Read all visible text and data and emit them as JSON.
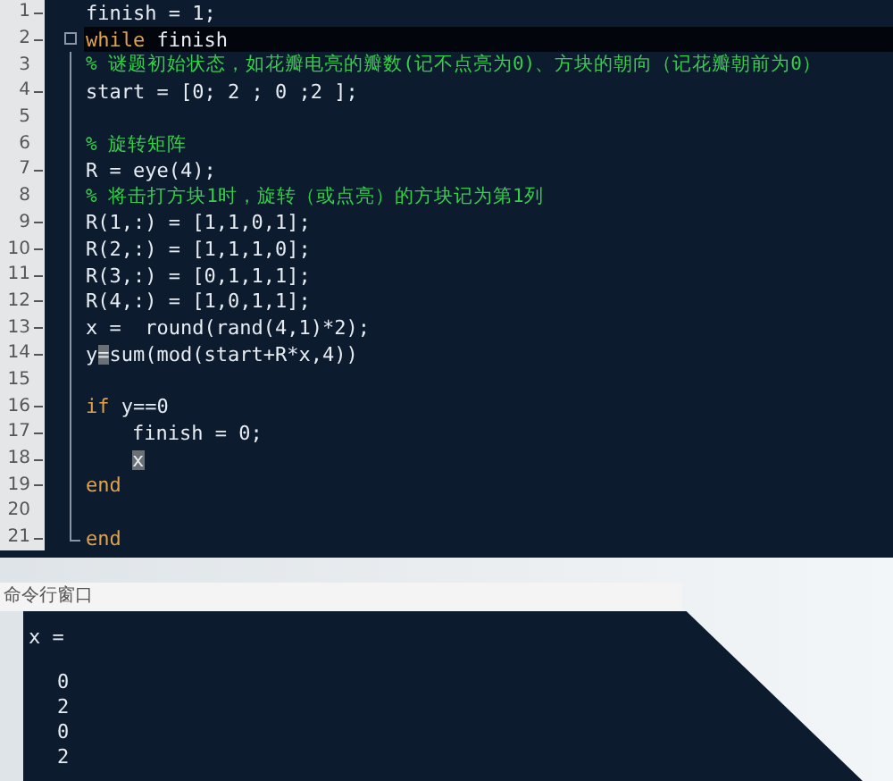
{
  "editor": {
    "lines": [
      {
        "number": "1",
        "dash": true,
        "kind": "plain",
        "current": false,
        "indented": false,
        "segments": [
          {
            "kind": "code",
            "text": "finish = 1;"
          }
        ]
      },
      {
        "number": "2",
        "dash": true,
        "kind": "foldstart",
        "current": true,
        "indented": false,
        "segments": [
          {
            "kind": "keyword",
            "text": "while"
          },
          {
            "kind": "code",
            "text": " finish"
          }
        ]
      },
      {
        "number": "3",
        "dash": false,
        "kind": "folded",
        "current": false,
        "indented": false,
        "segments": [
          {
            "kind": "comment",
            "text": "% 谜题初始状态，如花瓣电亮的瓣数(记不点亮为0)、方块的朝向（记花瓣朝前为0）"
          }
        ]
      },
      {
        "number": "4",
        "dash": true,
        "kind": "folded",
        "current": false,
        "indented": false,
        "segments": [
          {
            "kind": "code",
            "text": "start = [0; 2 ; 0 ;2 ];"
          }
        ]
      },
      {
        "number": "5",
        "dash": false,
        "kind": "folded",
        "current": false
      },
      {
        "number": "6",
        "dash": false,
        "kind": "folded",
        "current": false,
        "indented": false,
        "segments": [
          {
            "kind": "comment",
            "text": "% 旋转矩阵"
          }
        ]
      },
      {
        "number": "7",
        "dash": true,
        "kind": "folded",
        "current": false,
        "indented": false,
        "segments": [
          {
            "kind": "code",
            "text": "R = eye(4);"
          }
        ]
      },
      {
        "number": "8",
        "dash": false,
        "kind": "folded",
        "current": false,
        "indented": false,
        "segments": [
          {
            "kind": "comment",
            "text": "% 将击打方块1时，旋转（或点亮）的方块记为第1列"
          }
        ]
      },
      {
        "number": "9",
        "dash": true,
        "kind": "folded",
        "current": false,
        "indented": false,
        "segments": [
          {
            "kind": "code",
            "text": "R(1,:) = [1,1,0,1];"
          }
        ]
      },
      {
        "number": "10",
        "dash": true,
        "kind": "folded",
        "current": false,
        "indented": false,
        "segments": [
          {
            "kind": "code",
            "text": "R(2,:) = [1,1,1,0];"
          }
        ]
      },
      {
        "number": "11",
        "dash": true,
        "kind": "folded",
        "current": false,
        "indented": false,
        "segments": [
          {
            "kind": "code",
            "text": "R(3,:) = [0,1,1,1];"
          }
        ]
      },
      {
        "number": "12",
        "dash": true,
        "kind": "folded",
        "current": false,
        "indented": false,
        "segments": [
          {
            "kind": "code",
            "text": "R(4,:) = [1,0,1,1];"
          }
        ]
      },
      {
        "number": "13",
        "dash": true,
        "kind": "folded",
        "current": false,
        "indented": false,
        "segments": [
          {
            "kind": "code",
            "text": "x =  round(rand(4,1)*2);"
          }
        ]
      },
      {
        "number": "14",
        "dash": true,
        "kind": "folded",
        "current": false,
        "indented": false,
        "segments": [
          {
            "kind": "code",
            "text": "y"
          },
          {
            "kind": "selection",
            "text": "="
          },
          {
            "kind": "code",
            "text": "sum(mod(start+R*x,4))"
          }
        ]
      },
      {
        "number": "15",
        "dash": false,
        "kind": "folded",
        "current": false
      },
      {
        "number": "16",
        "dash": true,
        "kind": "folded",
        "current": false,
        "indented": false,
        "segments": [
          {
            "kind": "keyword",
            "text": "if"
          },
          {
            "kind": "code",
            "text": " y==0"
          }
        ]
      },
      {
        "number": "17",
        "dash": true,
        "kind": "folded",
        "current": false,
        "indented": true,
        "segments": [
          {
            "kind": "code",
            "text": "finish = 0;"
          }
        ]
      },
      {
        "number": "18",
        "dash": true,
        "kind": "folded",
        "current": false,
        "indented": true,
        "segments": [
          {
            "kind": "selection",
            "text": "x"
          }
        ]
      },
      {
        "number": "19",
        "dash": true,
        "kind": "folded",
        "current": false,
        "indented": false,
        "segments": [
          {
            "kind": "keyword",
            "text": "end"
          }
        ]
      },
      {
        "number": "20",
        "dash": false,
        "kind": "folded",
        "current": false
      },
      {
        "number": "21",
        "dash": true,
        "kind": "foldend",
        "current": false,
        "indented": false,
        "segments": [
          {
            "kind": "keyword",
            "text": "end"
          }
        ]
      }
    ]
  },
  "command_window": {
    "title": "命令行窗口",
    "variable_line": "x =",
    "values": [
      "0",
      "2",
      "0",
      "2"
    ]
  }
}
